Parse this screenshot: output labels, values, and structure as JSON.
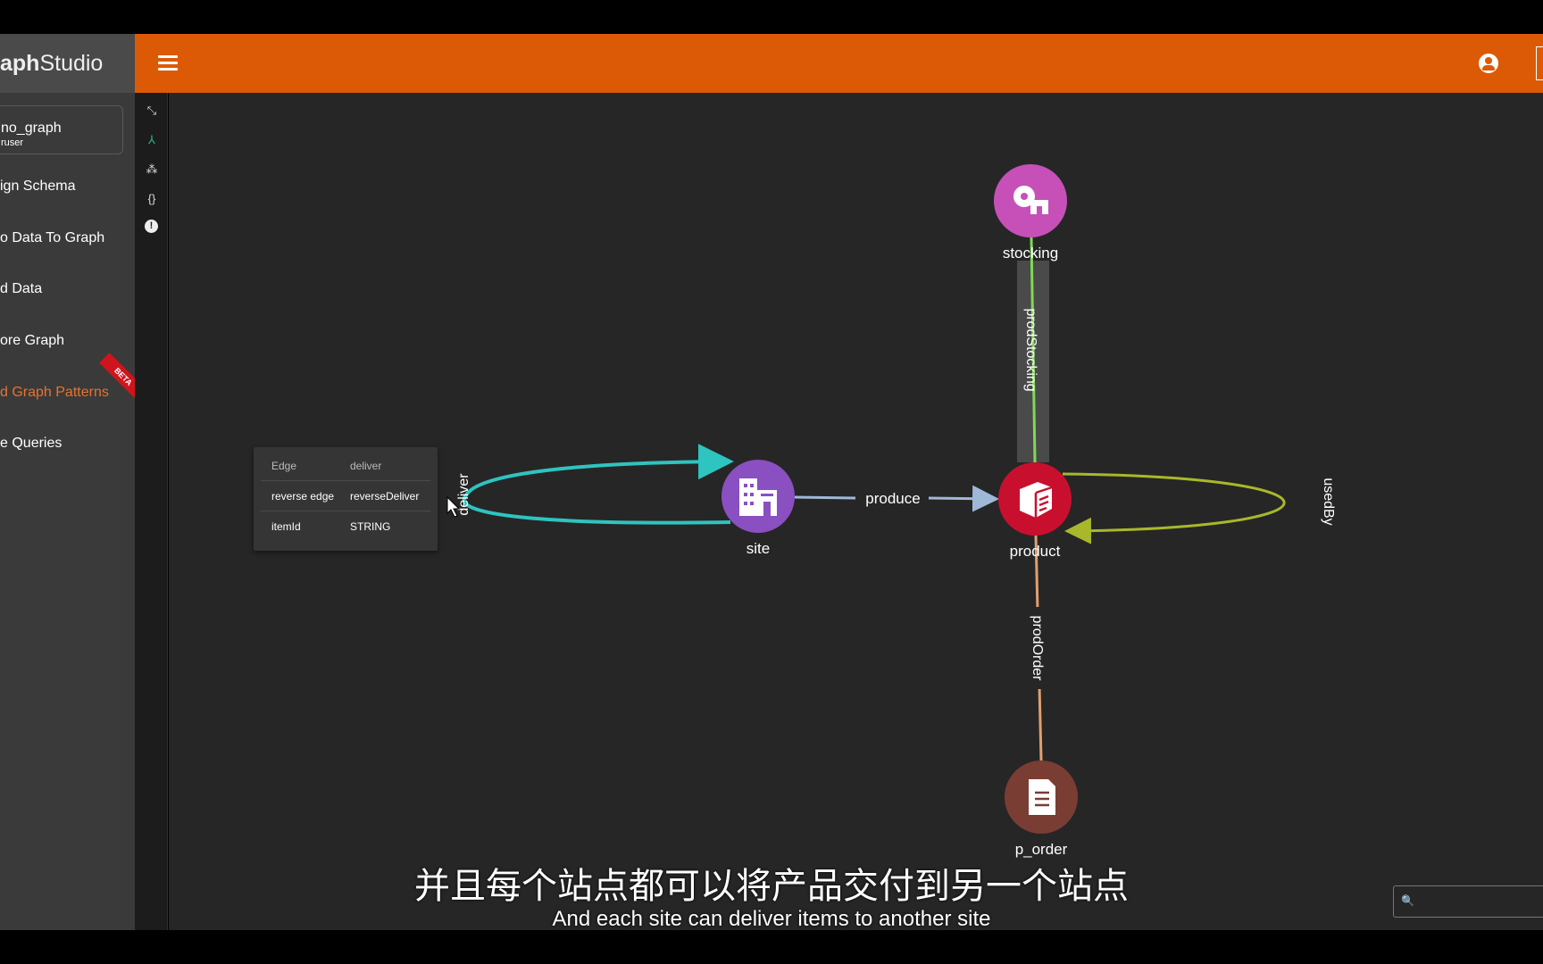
{
  "app": {
    "brand_bold": "aph",
    "brand_light": "Studio"
  },
  "header": {
    "menu_icon": "hamburger-icon",
    "user_icon": "account-circle-icon"
  },
  "sidebar": {
    "graph_name": "no_graph",
    "graph_user": "ruser",
    "items": [
      {
        "label": "ign Schema"
      },
      {
        "label": "o Data To Graph"
      },
      {
        "label": "d Data"
      },
      {
        "label": "ore Graph"
      },
      {
        "label": "d Graph Patterns",
        "active": true,
        "badge": "BETA"
      },
      {
        "label": "e Queries"
      }
    ]
  },
  "rail": {
    "icons": [
      "collapse-icon",
      "schema-icon",
      "graph-layout-icon",
      "json-icon",
      "alert-icon"
    ],
    "glyphs": [
      "⤡",
      "⅄",
      "⁂",
      "{}",
      "!"
    ],
    "active_color": "#2bb389"
  },
  "graph": {
    "nodes": [
      {
        "id": "stocking",
        "label": "stocking",
        "color": "#c650b8"
      },
      {
        "id": "site",
        "label": "site",
        "color": "#8a4fc0"
      },
      {
        "id": "product",
        "label": "product",
        "color": "#c8102e"
      },
      {
        "id": "p_order",
        "label": "p_order",
        "color": "#7a3d33"
      }
    ],
    "edges": [
      {
        "label": "prodStocking",
        "from": "stocking",
        "to": "product",
        "color": "#7ed957"
      },
      {
        "label": "produce",
        "from": "site",
        "to": "product",
        "color": "#9fb8d8"
      },
      {
        "label": "usedBy",
        "from": "product",
        "to": "product",
        "color": "#a8b82a"
      },
      {
        "label": "prodOrder",
        "from": "product",
        "to": "p_order",
        "color": "#e0a070"
      },
      {
        "label": "deliver",
        "from": "site",
        "to": "site",
        "color": "#2ec4c0"
      }
    ]
  },
  "tooltip": {
    "rows": [
      {
        "k": "Edge",
        "v": "deliver"
      },
      {
        "k": "reverse edge",
        "v": "reverseDeliver"
      },
      {
        "k": "itemId",
        "v": "STRING"
      }
    ]
  },
  "subtitles": {
    "zh": "并且每个站点都可以将产品交付到另一个站点",
    "en": "And each site can deliver items to another site"
  },
  "search": {
    "icon": "search-icon",
    "glyph": "🔍"
  }
}
